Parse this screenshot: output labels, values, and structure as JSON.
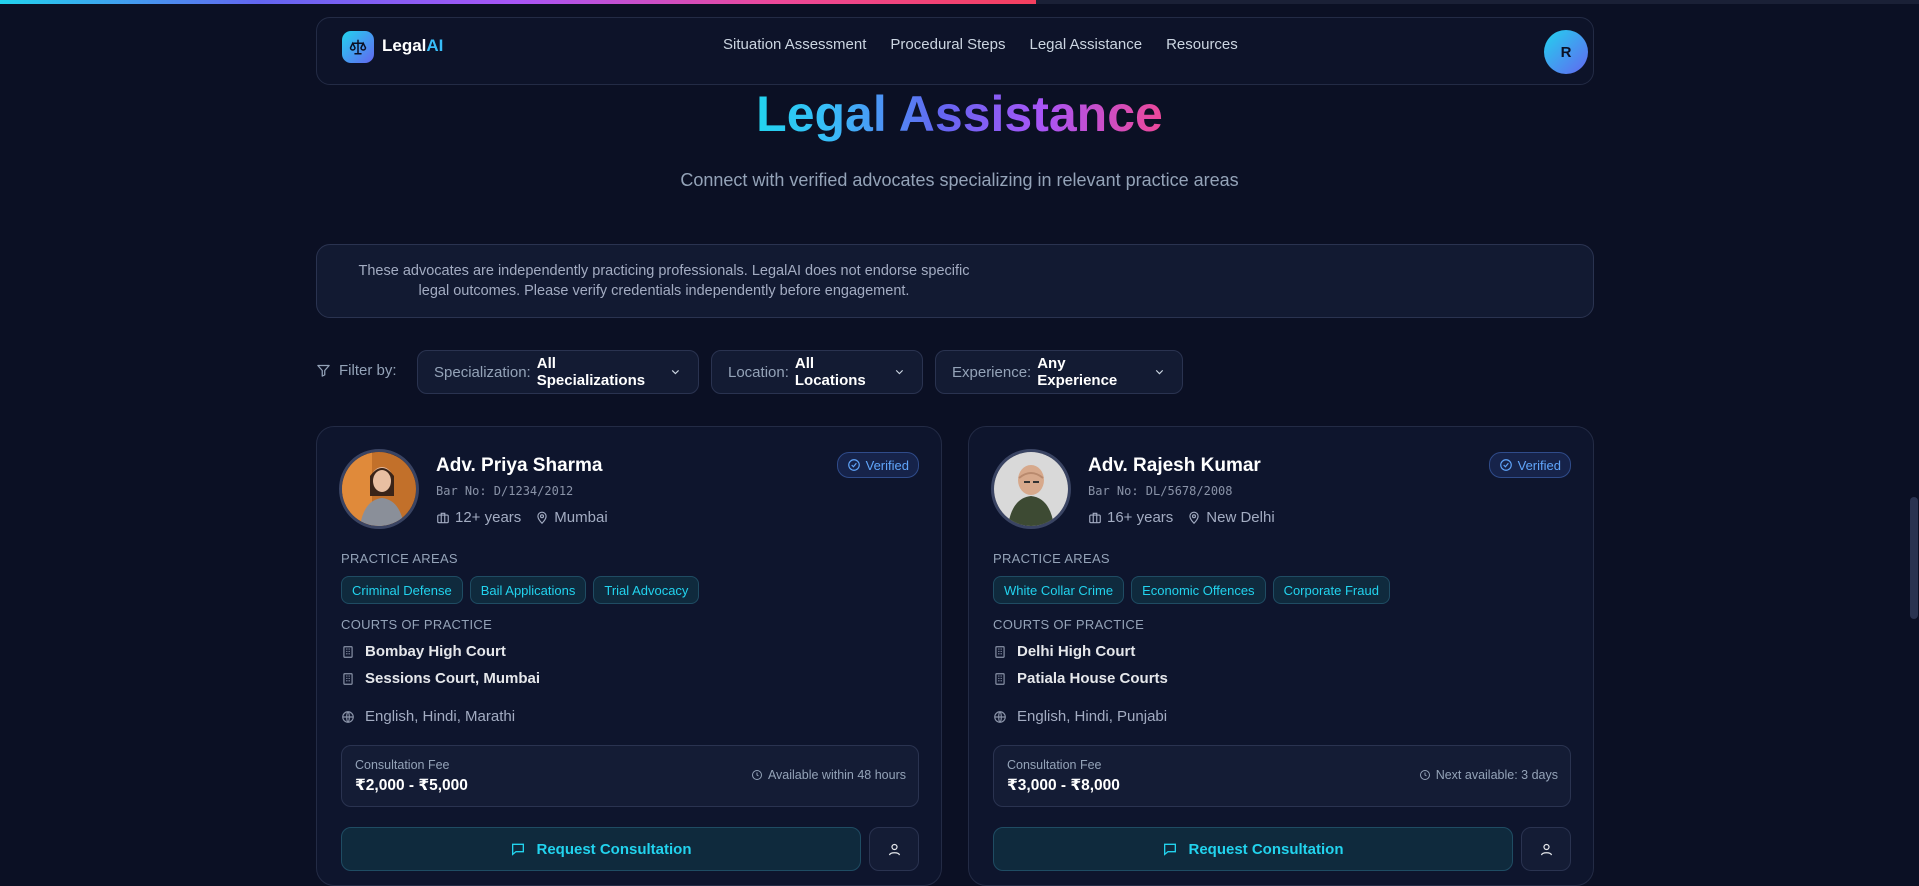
{
  "brand": {
    "name_main": "Legal",
    "name_accent": "AI"
  },
  "nav": {
    "links": [
      "Situation Assessment",
      "Procedural Steps",
      "Legal Assistance",
      "Resources"
    ],
    "user_initial": "R"
  },
  "scroll_progress": 0.54,
  "hero": {
    "title": "Legal Assistance",
    "subtitle": "Connect with verified advocates specializing in relevant practice areas"
  },
  "disclaimer": "These advocates are independently practicing professionals. LegalAI does not endorse specific legal outcomes. Please verify credentials independently before engagement.",
  "filters": {
    "label": "Filter by:",
    "specialization": {
      "key": "Specialization:",
      "value": "All Specializations"
    },
    "location": {
      "key": "Location:",
      "value": "All Locations"
    },
    "experience": {
      "key": "Experience:",
      "value": "Any Experience"
    }
  },
  "labels": {
    "practice_areas": "PRACTICE AREAS",
    "courts": "COURTS OF PRACTICE",
    "fee": "Consultation Fee",
    "verified": "Verified",
    "request": "Request Consultation"
  },
  "advocates": [
    {
      "name": "Adv. Priya Sharma",
      "bar_no": "Bar No: D/1234/2012",
      "experience": "12+ years",
      "city": "Mumbai",
      "practice_areas": [
        "Criminal Defense",
        "Bail Applications",
        "Trial Advocacy"
      ],
      "courts": [
        "Bombay High Court",
        "Sessions Court, Mumbai"
      ],
      "languages": "English, Hindi, Marathi",
      "fee": "₹2,000 - ₹5,000",
      "availability": "Available within 48 hours"
    },
    {
      "name": "Adv. Rajesh Kumar",
      "bar_no": "Bar No: DL/5678/2008",
      "experience": "16+ years",
      "city": "New Delhi",
      "practice_areas": [
        "White Collar Crime",
        "Economic Offences",
        "Corporate Fraud"
      ],
      "courts": [
        "Delhi High Court",
        "Patiala House Courts"
      ],
      "languages": "English, Hindi, Punjabi",
      "fee": "₹3,000 - ₹8,000",
      "availability": "Next available: 3 days"
    }
  ],
  "colors": {
    "accent": "#22d3ee",
    "verified": "#60a5fa",
    "bg": "#0b1024"
  }
}
